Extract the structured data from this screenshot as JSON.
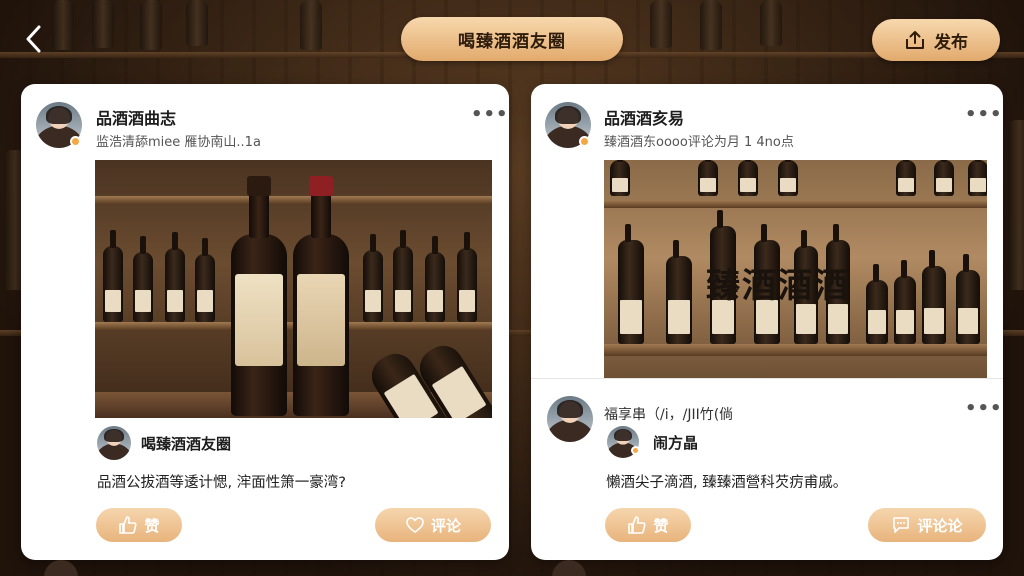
{
  "header": {
    "title": "喝臻酒酒友圈",
    "publish_label": "发布"
  },
  "posts": [
    {
      "author": "品酒酒曲志",
      "meta": "监浩清舔miee 雁协南山..1a",
      "image_overlay_text": "",
      "sub_author": "喝臻酒酒友圈",
      "text": "品酒公拔酒等逶计愢, 浶面性箫一豪湾?",
      "like_label": "赞",
      "comment_label": "评论"
    },
    {
      "author": "品酒酒亥易",
      "meta": "臻酒酒东oooo评论为月 1 4no点",
      "image_overlay_text": "臻酒酒酒",
      "sub_author_line": "福享串（/i，/JII竹(倘",
      "sub_author": "闹方晶",
      "text": "懶酒尖子滴酒, 臻臻酒營科芡疠甫戚。",
      "like_label": "赞",
      "comment_label": "评论论"
    }
  ],
  "colors": {
    "accent_gold": "#e2aa6d",
    "accent_light": "#f7d8ad",
    "online": "#f4a742"
  },
  "icons": {
    "back": "chevron-left-icon",
    "publish": "share-upload-icon",
    "more": "more-dots-icon",
    "like": "thumbs-up-icon",
    "comment": "speech-bubble-icon"
  }
}
